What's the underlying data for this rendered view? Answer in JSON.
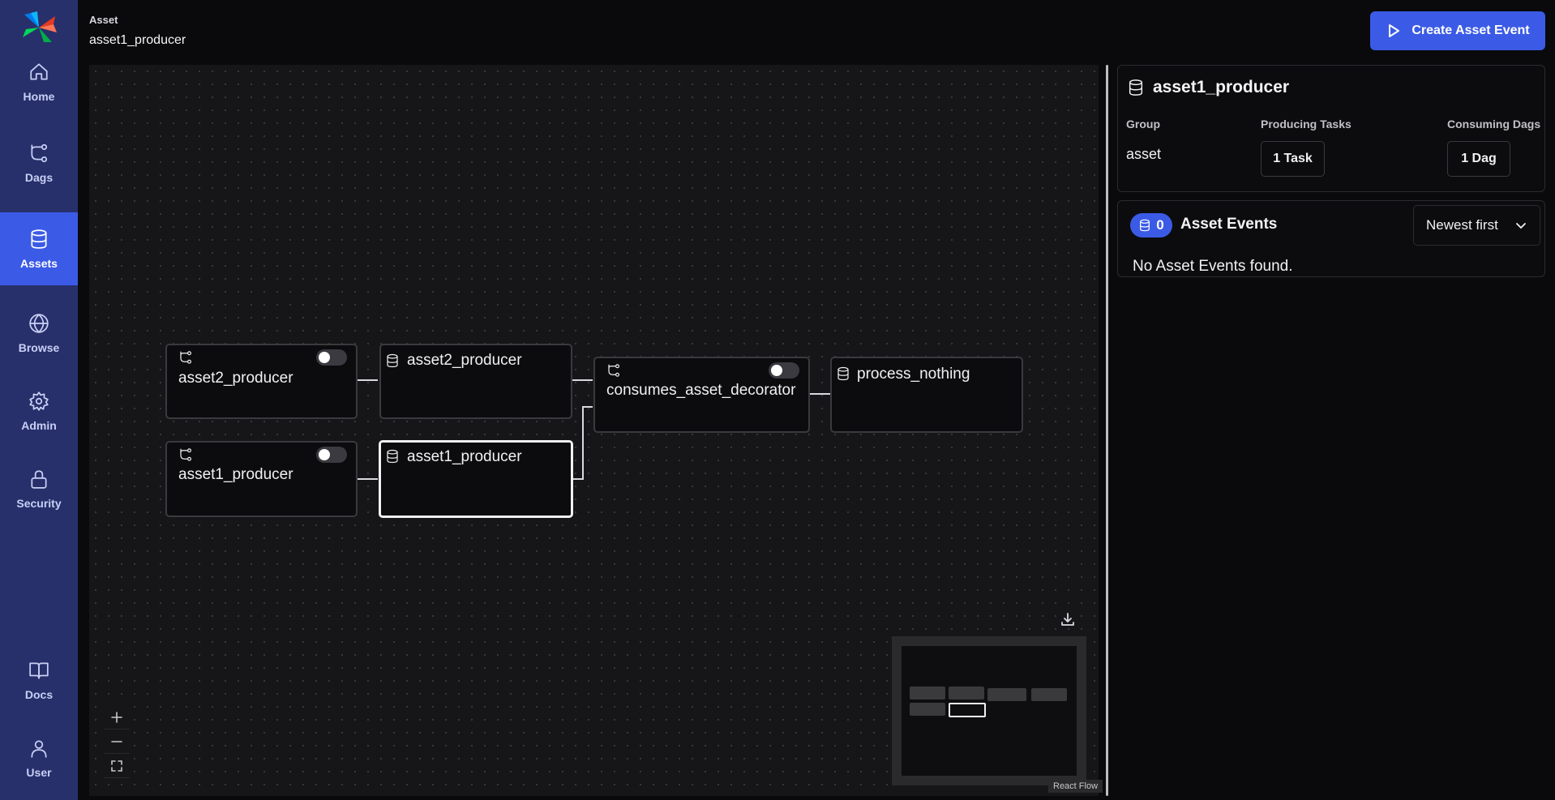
{
  "sidebar": {
    "items": [
      {
        "label": "Home",
        "icon": "home-icon"
      },
      {
        "label": "Dags",
        "icon": "dags-icon"
      },
      {
        "label": "Assets",
        "icon": "database-icon",
        "active": true
      },
      {
        "label": "Browse",
        "icon": "globe-icon"
      },
      {
        "label": "Admin",
        "icon": "gear-icon"
      },
      {
        "label": "Security",
        "icon": "lock-icon"
      },
      {
        "label": "Docs",
        "icon": "book-icon"
      },
      {
        "label": "User",
        "icon": "user-icon"
      }
    ]
  },
  "header": {
    "breadcrumb_label": "Asset",
    "breadcrumb_value": "asset1_producer",
    "create_button": "Create Asset Event"
  },
  "graph": {
    "nodes": [
      {
        "label": "asset2_producer",
        "kind": "dag",
        "toggle_on": false
      },
      {
        "label": "asset2_producer",
        "kind": "asset"
      },
      {
        "label": "consumes_asset_decorator",
        "kind": "dag",
        "toggle_on": false
      },
      {
        "label": "process_nothing",
        "kind": "asset"
      },
      {
        "label": "asset1_producer",
        "kind": "dag",
        "toggle_on": false
      },
      {
        "label": "asset1_producer",
        "kind": "asset",
        "selected": true
      }
    ],
    "attribution": "React Flow"
  },
  "details": {
    "title": "asset1_producer",
    "group_label": "Group",
    "group_value": "asset",
    "producing_label": "Producing Tasks",
    "producing_button": "1 Task",
    "consuming_label": "Consuming Dags",
    "consuming_button": "1 Dag"
  },
  "events": {
    "count": "0",
    "title": "Asset Events",
    "sort_value": "Newest first",
    "empty_message": "No Asset Events found."
  },
  "colors": {
    "sidebar_bg": "#27306b",
    "accent": "#3b5be6",
    "background": "#0a0a0c"
  }
}
